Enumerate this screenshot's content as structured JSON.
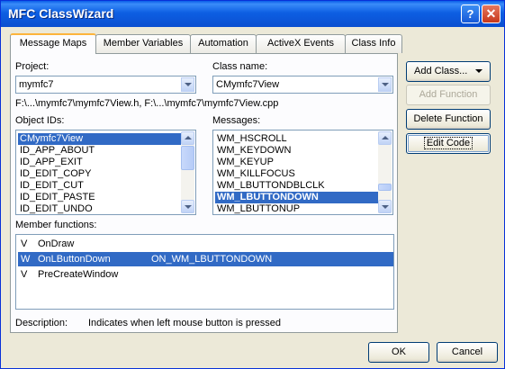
{
  "window": {
    "title": "MFC ClassWizard"
  },
  "titlebar": {
    "help_glyph": "?",
    "close_glyph": "✕"
  },
  "tabs": [
    {
      "label": "Message Maps"
    },
    {
      "label": "Member Variables"
    },
    {
      "label": "Automation"
    },
    {
      "label": "ActiveX Events"
    },
    {
      "label": "Class Info"
    }
  ],
  "project": {
    "label": "Project:",
    "value": "mymfc7"
  },
  "class_name": {
    "label": "Class name:",
    "value": "CMymfc7View"
  },
  "files_path": "F:\\...\\mymfc7\\mymfc7View.h, F:\\...\\mymfc7\\mymfc7View.cpp",
  "object_ids": {
    "label": "Object IDs:",
    "items": [
      "CMymfc7View",
      "ID_APP_ABOUT",
      "ID_APP_EXIT",
      "ID_EDIT_COPY",
      "ID_EDIT_CUT",
      "ID_EDIT_PASTE",
      "ID_EDIT_UNDO"
    ],
    "selected_index": 0
  },
  "messages": {
    "label": "Messages:",
    "items": [
      "WM_HSCROLL",
      "WM_KEYDOWN",
      "WM_KEYUP",
      "WM_KILLFOCUS",
      "WM_LBUTTONDBLCLK",
      "WM_LBUTTONDOWN",
      "WM_LBUTTONUP"
    ],
    "selected_index": 5
  },
  "member_functions": {
    "label": "Member functions:",
    "rows": [
      {
        "flag": "V",
        "name": "OnDraw",
        "message": ""
      },
      {
        "flag": "W",
        "name": "OnLButtonDown",
        "message": "ON_WM_LBUTTONDOWN"
      },
      {
        "flag": "V",
        "name": "PreCreateWindow",
        "message": ""
      }
    ],
    "selected_index": 1
  },
  "description": {
    "label": "Description:",
    "text": "Indicates when left mouse button is pressed"
  },
  "buttons": {
    "add_class": "Add Class...",
    "add_function": "Add Function",
    "delete_function": "Delete Function",
    "edit_code": "Edit Code",
    "ok": "OK",
    "cancel": "Cancel"
  },
  "colors": {
    "selection": "#316ac5",
    "titlebar": "#0a5de8",
    "dialog_bg": "#ece9d8"
  }
}
